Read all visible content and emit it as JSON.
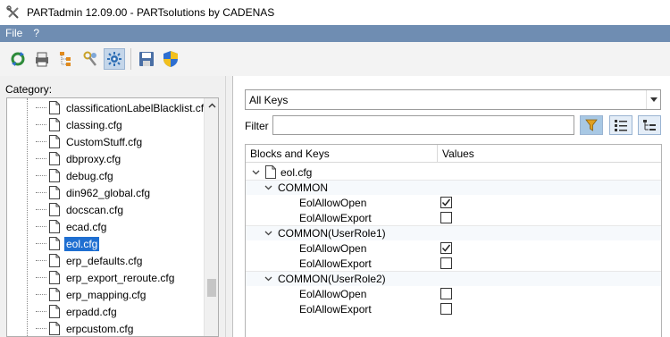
{
  "window": {
    "title": "PARTadmin 12.09.00 - PARTsolutions by CADENAS"
  },
  "menu": {
    "items": [
      "File",
      "?"
    ]
  },
  "toolbar": {
    "buttons": [
      "refresh-icon",
      "printer-icon",
      "hierarchy-icon",
      "key-user-icon",
      "settings-icon",
      "save-icon",
      "shield-icon"
    ],
    "active": "settings-icon"
  },
  "left": {
    "category_label": "Category:",
    "files": [
      {
        "name": "classificationLabelBlacklist.cfg",
        "selected": false
      },
      {
        "name": "classing.cfg",
        "selected": false
      },
      {
        "name": "CustomStuff.cfg",
        "selected": false
      },
      {
        "name": "dbproxy.cfg",
        "selected": false
      },
      {
        "name": "debug.cfg",
        "selected": false
      },
      {
        "name": "din962_global.cfg",
        "selected": false
      },
      {
        "name": "docscan.cfg",
        "selected": false
      },
      {
        "name": "ecad.cfg",
        "selected": false
      },
      {
        "name": "eol.cfg",
        "selected": true
      },
      {
        "name": "erp_defaults.cfg",
        "selected": false
      },
      {
        "name": "erp_export_reroute.cfg",
        "selected": false
      },
      {
        "name": "erp_mapping.cfg",
        "selected": false
      },
      {
        "name": "erpadd.cfg",
        "selected": false
      },
      {
        "name": "erpcustom.cfg",
        "selected": false
      }
    ]
  },
  "right": {
    "keys_dropdown": {
      "selected": "All Keys"
    },
    "filter": {
      "label": "Filter",
      "value": ""
    },
    "grid": {
      "headers": [
        "Blocks and Keys",
        "Values"
      ],
      "root": "eol.cfg",
      "blocks": [
        {
          "name": "COMMON",
          "keys": [
            {
              "key": "EolAllowOpen",
              "checked": true
            },
            {
              "key": "EolAllowExport",
              "checked": false
            }
          ]
        },
        {
          "name": "COMMON(UserRole1)",
          "keys": [
            {
              "key": "EolAllowOpen",
              "checked": true
            },
            {
              "key": "EolAllowExport",
              "checked": false
            }
          ]
        },
        {
          "name": "COMMON(UserRole2)",
          "keys": [
            {
              "key": "EolAllowOpen",
              "checked": false
            },
            {
              "key": "EolAllowExport",
              "checked": false
            }
          ]
        }
      ]
    }
  },
  "colors": {
    "menubar": "#6f8db2",
    "selection": "#1f6fd1"
  }
}
